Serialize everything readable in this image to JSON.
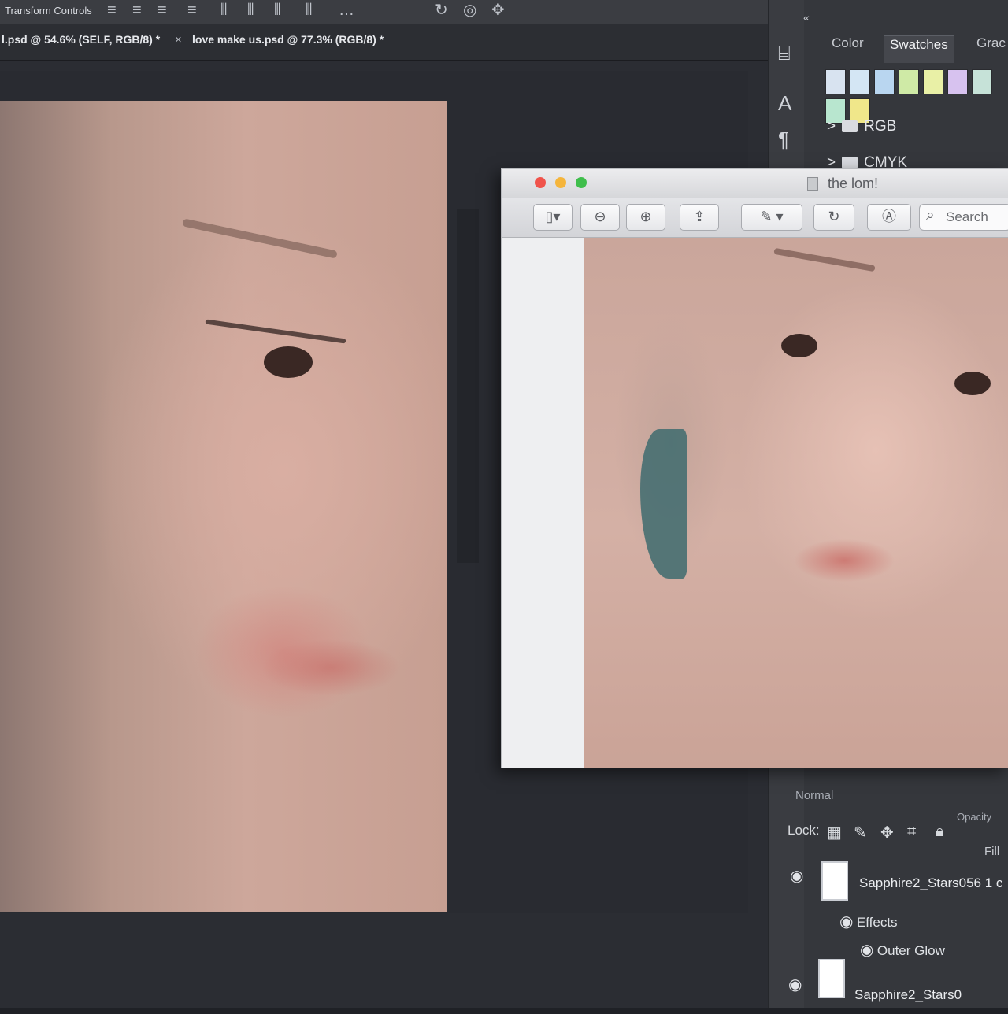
{
  "options_bar": {
    "transform_label": "Transform Controls"
  },
  "document_tabs": [
    {
      "label": "l.psd @ 54.6% (SELF, RGB/8) *"
    },
    {
      "close": "×",
      "label": "love make us.psd @ 77.3% (RGB/8) *"
    }
  ],
  "panels": {
    "collapse_glyph": "«",
    "tabs": [
      {
        "label": "Color",
        "active": false
      },
      {
        "label": "Swatches",
        "active": true
      },
      {
        "label": "Grac",
        "active": false
      }
    ],
    "swatch_colors": [
      "#d8e3f0",
      "#d4e6f4",
      "#b9d6f0",
      "#cfeaa6",
      "#e9f0a6",
      "#d7c2ef",
      "#c6e2d8",
      "#b8e6cf",
      "#f0e78a"
    ],
    "swatch_folders": [
      {
        "arrow": ">",
        "label": "RGB"
      },
      {
        "arrow": ">",
        "label": "CMYK"
      }
    ]
  },
  "layers_panel": {
    "blend_mode": "Normal",
    "opacity_label": "Opacity",
    "lock_label": "Lock:",
    "fill_label": "Fill",
    "layers": [
      {
        "name": "Sapphire2_Stars056 1 c"
      },
      {
        "name": "Sapphire2_Stars0"
      }
    ],
    "effects_label": "Effects",
    "effect_name": "Outer Glow"
  },
  "preview_window": {
    "title": "the lom!",
    "search_placeholder": "Search"
  },
  "colors": {
    "close": "#f0534b",
    "minimize": "#f5b53b",
    "maximize": "#3fbe4c",
    "panel_bg": "#35373c"
  }
}
